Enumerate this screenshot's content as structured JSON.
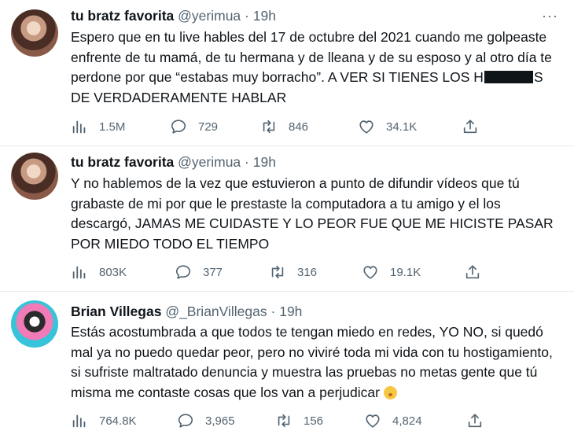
{
  "tweets": [
    {
      "name": "tu bratz favorita",
      "handle": "@yerimua",
      "dot": "·",
      "time": "19h",
      "more": "···",
      "text_before": "Espero que en tu live hables del 17 de octubre del 2021 cuando me golpeaste enfrente de tu mamá, de tu hermana y de lleana y de su esposo y al otro día te perdone por que “estabas muy borracho”. A VER SI TIENES LOS H",
      "text_after": "S DE VERDADERAMENTE HABLAR",
      "views": "1.5M",
      "replies": "729",
      "retweets": "846",
      "likes": "34.1K"
    },
    {
      "name": "tu bratz favorita",
      "handle": "@yerimua",
      "dot": "·",
      "time": "19h",
      "text": "Y no hablemos de la vez que estuvieron a punto de difundir vídeos que tú grabaste de mi por que le prestaste la computadora a tu amigo y el los descargó, JAMAS ME CUIDASTE Y LO PEOR FUE QUE ME HICISTE PASAR POR MIEDO TODO EL TIEMPO",
      "views": "803K",
      "replies": "377",
      "retweets": "316",
      "likes": "19.1K"
    },
    {
      "name": "Brian Villegas",
      "handle": "@_BrianVillegas",
      "dot": "·",
      "time": "19h",
      "text": "Estás acostumbrada a que todos te tengan miedo en redes, YO NO, si quedó mal ya no puedo quedar peor, pero no viviré toda mi vida con tu hostigamiento, si sufriste maltratado denuncia y muestra las pruebas no metas gente que tú misma me contaste cosas que los van a perjudicar",
      "views": "764.8K",
      "replies": "3,965",
      "retweets": "156",
      "likes": "4,824"
    }
  ],
  "icons": {
    "views": "analytics-icon",
    "reply": "reply-icon",
    "retweet": "retweet-icon",
    "like": "heart-icon",
    "share": "share-icon",
    "emoji": "shushing-face-emoji"
  },
  "colors": {
    "text": "#0f1419",
    "secondary": "#536471",
    "divider": "#e6ecf0"
  }
}
